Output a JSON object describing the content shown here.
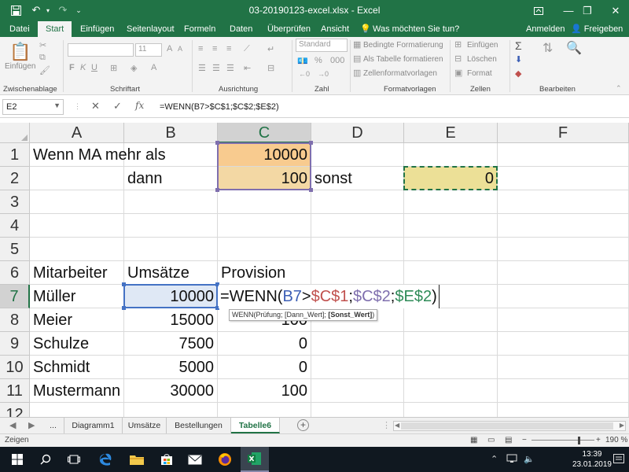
{
  "window": {
    "title": "03-20190123-excel.xlsx  -  Excel",
    "save_icon": "save-icon",
    "undo_icon": "undo-icon",
    "redo_icon": "redo-icon"
  },
  "ribbon_tabs": [
    "Datei",
    "Start",
    "Einfügen",
    "Seitenlayout",
    "Formeln",
    "Daten",
    "Überprüfen",
    "Ansicht"
  ],
  "tell_me": "Was möchten Sie tun?",
  "account": {
    "signin": "Anmelden",
    "share": "Freigeben"
  },
  "ribbon": {
    "clipboard": {
      "paste": "Einfügen",
      "label": "Zwischenablage"
    },
    "font": {
      "font_name": "",
      "font_size": "11",
      "label": "Schriftart"
    },
    "alignment": {
      "label": "Ausrichtung"
    },
    "number": {
      "format": "Standard",
      "label": "Zahl"
    },
    "styles": {
      "conditional": "Bedingte Formatierung",
      "as_table": "Als Tabelle formatieren",
      "cell_styles": "Zellenformatvorlagen",
      "label": "Formatvorlagen"
    },
    "cells": {
      "insert": "Einfügen",
      "delete": "Löschen",
      "format": "Format",
      "label": "Zellen"
    },
    "editing": {
      "label": "Bearbeiten"
    }
  },
  "formula_bar": {
    "name_box": "E2",
    "formula": "=WENN(B7>$C$1;$C$2;$E$2)",
    "cancel": "✕",
    "enter": "✓",
    "fx": "fx"
  },
  "columns": [
    "A",
    "B",
    "C",
    "D",
    "E",
    "F"
  ],
  "rows": [
    "1",
    "2",
    "3",
    "4",
    "5",
    "6",
    "7",
    "8",
    "9",
    "10",
    "11",
    "12"
  ],
  "cells": {
    "A1": "Wenn MA mehr als",
    "C1": "10000",
    "B2": "dann",
    "C2": "100",
    "D2": "sonst",
    "E2": "0",
    "A6": "Mitarbeiter",
    "B6": "Umsätze",
    "C6": "Provision",
    "A7": "Müller",
    "B7": "10000",
    "A8": "Meier",
    "B8": "15000",
    "C8": "100",
    "A9": "Schulze",
    "B9": "7500",
    "C9": "0",
    "A10": "Schmidt",
    "B10": "5000",
    "C10": "0",
    "A11": "Mustermann",
    "B11": "30000",
    "C11": "100"
  },
  "edit_cell": {
    "prefix": "=WENN(",
    "ref_b7": "B7",
    "op": ">",
    "ref_c1": "$C$1",
    "sep1": ";",
    "ref_c2": "$C$2",
    "sep2": ";",
    "ref_e2": "$E$2",
    "suffix": ")"
  },
  "tooltip": {
    "text": "WENN(Prüfung; [Dann_Wert]; ",
    "bold": "[Sonst_Wert]",
    "end": ")"
  },
  "sheets": {
    "more": "...",
    "tabs": [
      "Diagramm1",
      "Umsätze",
      "Bestellungen",
      "Tabelle6"
    ],
    "active": "Tabelle6"
  },
  "status": {
    "mode": "Zeigen",
    "zoom": "190 %"
  },
  "taskbar": {
    "time": "13:39",
    "date": "23.01.2019"
  },
  "colors": {
    "excel_green": "#217346",
    "orange": "#f8cb8f",
    "tan": "#f3d8a4",
    "yellow": "#ece097",
    "ref_blue": "#3b5eb5",
    "ref_red": "#c0504d",
    "ref_purple": "#7f6fae",
    "ref_green": "#2e8b57"
  }
}
